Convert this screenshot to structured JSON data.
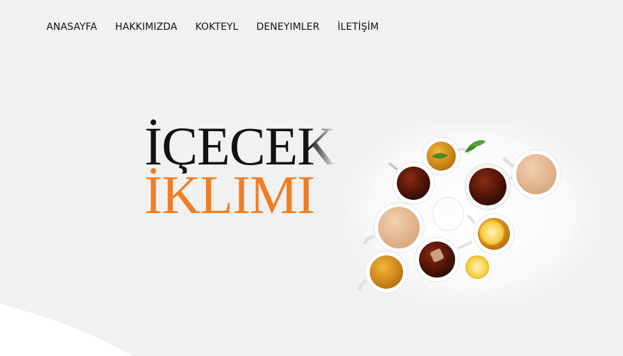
{
  "nav": {
    "items": [
      {
        "label": "ANASAYFA"
      },
      {
        "label": "HAKKIMIZDA"
      },
      {
        "label": "KOKTEYL"
      },
      {
        "label": "DENEYIMLER"
      },
      {
        "label": "İLETİŞİM"
      }
    ]
  },
  "hero": {
    "title_line1": "İÇECEK",
    "title_line2": "İKLIMI"
  },
  "colors": {
    "background": "#f1f1f1",
    "accent": "#ef7e23",
    "text": "#121212",
    "swoosh": "#ffffff"
  }
}
